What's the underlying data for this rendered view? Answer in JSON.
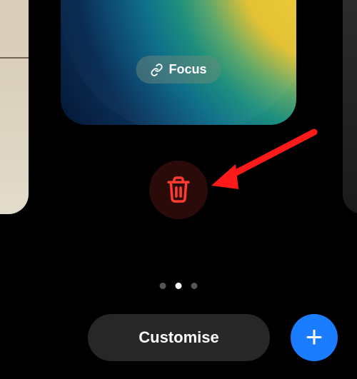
{
  "focus": {
    "label": "Focus"
  },
  "actions": {
    "customise_label": "Customise",
    "add_glyph": "+"
  },
  "pager": {
    "count": 3,
    "active_index": 1
  },
  "colors": {
    "accent_blue": "#1a7cff",
    "danger": "#ff3b30"
  }
}
